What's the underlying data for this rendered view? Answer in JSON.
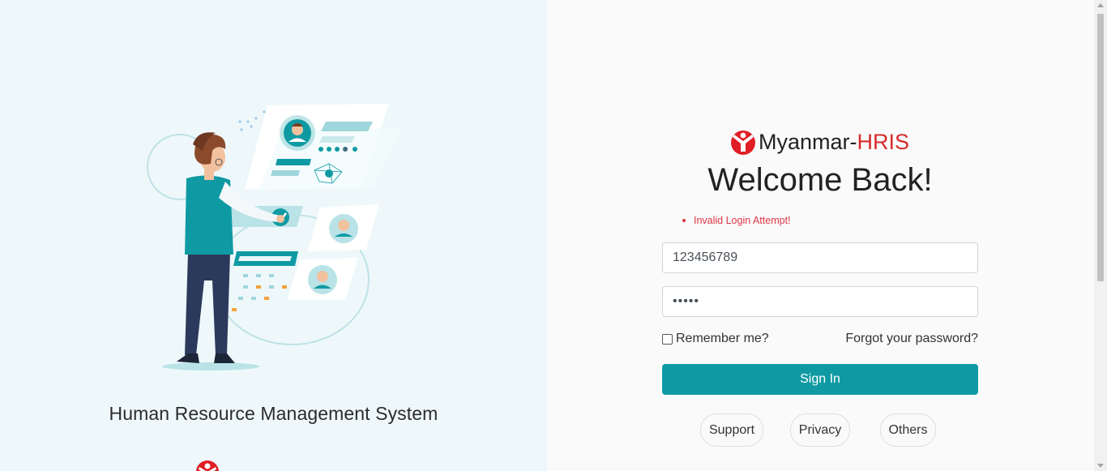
{
  "left": {
    "title": "Human Resource Management System",
    "illustration": "hr-profiles-illustration"
  },
  "brand": {
    "name": "Myanmar-",
    "accent": "HRIS",
    "logo": "save-the-children-logo"
  },
  "login": {
    "heading": "Welcome Back!",
    "error": "Invalid Login Attempt!",
    "username_value": "123456789",
    "password_value": "•••••",
    "remember_label": "Remember me?",
    "remember_checked": false,
    "forgot_label": "Forgot your password?",
    "signin_label": "Sign In"
  },
  "links": {
    "support": "Support",
    "privacy": "Privacy",
    "others": "Others"
  },
  "colors": {
    "primary": "#0f9aa3",
    "accent": "#d62b2b",
    "error": "#dc3545",
    "left_bg": "#eef8fa"
  }
}
